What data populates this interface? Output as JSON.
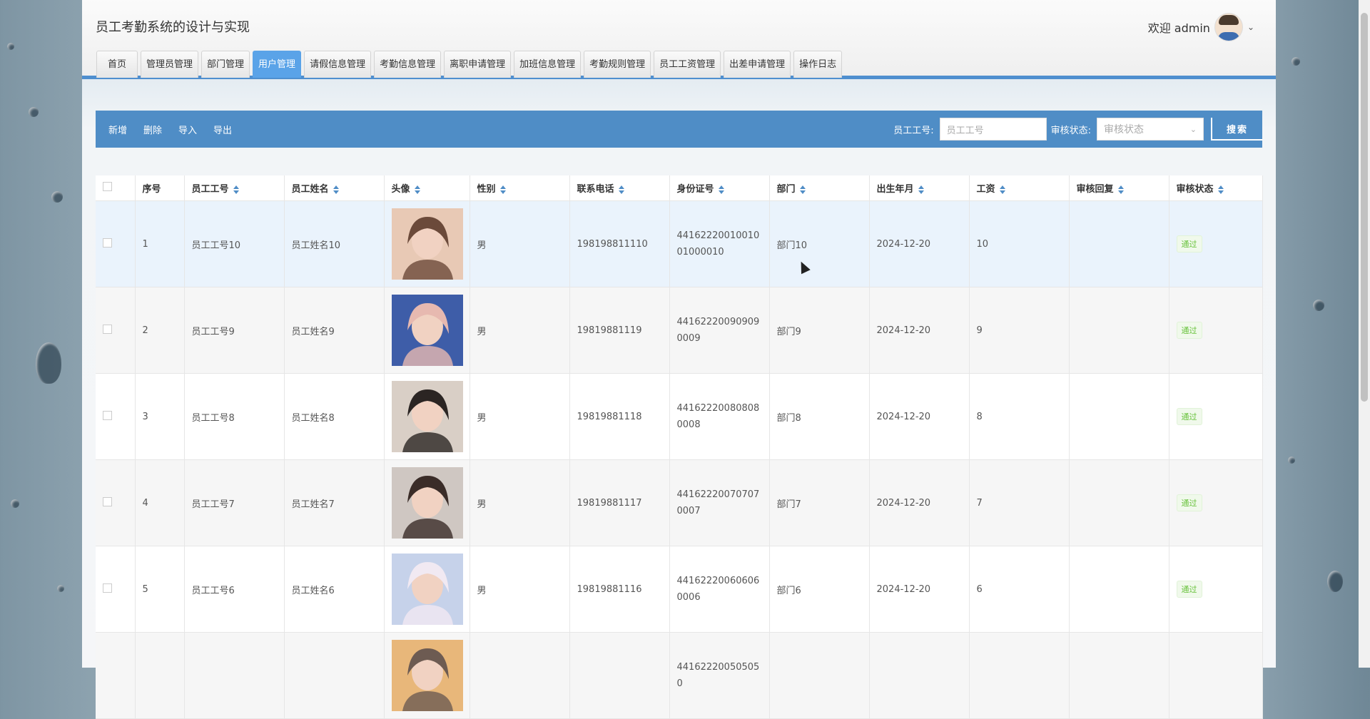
{
  "app": {
    "title": "员工考勤系统的设计与实现",
    "welcome": "欢迎 admin"
  },
  "nav": {
    "tabs": [
      {
        "label": "首页",
        "active": false
      },
      {
        "label": "管理员管理",
        "active": false
      },
      {
        "label": "部门管理",
        "active": false
      },
      {
        "label": "用户管理",
        "active": true
      },
      {
        "label": "请假信息管理",
        "active": false
      },
      {
        "label": "考勤信息管理",
        "active": false
      },
      {
        "label": "离职申请管理",
        "active": false
      },
      {
        "label": "加班信息管理",
        "active": false
      },
      {
        "label": "考勤规则管理",
        "active": false
      },
      {
        "label": "员工工资管理",
        "active": false
      },
      {
        "label": "出差申请管理",
        "active": false
      },
      {
        "label": "操作日志",
        "active": false
      }
    ]
  },
  "toolbar": {
    "add": "新增",
    "delete": "删除",
    "import": "导入",
    "export": "导出",
    "employee_no_label": "员工工号:",
    "employee_no_placeholder": "员工工号",
    "status_label": "审核状态:",
    "status_placeholder": "审核状态",
    "search": "搜索"
  },
  "table": {
    "headers": [
      "序号",
      "员工工号",
      "员工姓名",
      "头像",
      "性别",
      "联系电话",
      "身份证号",
      "部门",
      "出生年月",
      "工资",
      "审核回复",
      "审核状态"
    ],
    "rows": [
      {
        "idx": "1",
        "no": "员工工号10",
        "name": "员工姓名10",
        "gender": "男",
        "phone": "198198811110",
        "id": "4416222001001001000010",
        "dept": "部门10",
        "birth": "2024-12-20",
        "salary": "10",
        "reply": "",
        "status": "通过"
      },
      {
        "idx": "2",
        "no": "员工工号9",
        "name": "员工姓名9",
        "gender": "男",
        "phone": "19819881119",
        "id": "441622200909090009",
        "dept": "部门9",
        "birth": "2024-12-20",
        "salary": "9",
        "reply": "",
        "status": "通过"
      },
      {
        "idx": "3",
        "no": "员工工号8",
        "name": "员工姓名8",
        "gender": "男",
        "phone": "19819881118",
        "id": "441622200808080008",
        "dept": "部门8",
        "birth": "2024-12-20",
        "salary": "8",
        "reply": "",
        "status": "通过"
      },
      {
        "idx": "4",
        "no": "员工工号7",
        "name": "员工姓名7",
        "gender": "男",
        "phone": "19819881117",
        "id": "441622200707070007",
        "dept": "部门7",
        "birth": "2024-12-20",
        "salary": "7",
        "reply": "",
        "status": "通过"
      },
      {
        "idx": "5",
        "no": "员工工号6",
        "name": "员工姓名6",
        "gender": "男",
        "phone": "19819881116",
        "id": "441622200606060006",
        "dept": "部门6",
        "birth": "2024-12-20",
        "salary": "6",
        "reply": "",
        "status": "通过"
      },
      {
        "idx": "",
        "no": "",
        "name": "",
        "gender": "",
        "phone": "",
        "id": "441622200505050",
        "dept": "",
        "birth": "",
        "salary": "",
        "reply": "",
        "status": ""
      }
    ],
    "photo_colors": [
      [
        "#e8c9b5",
        "#6b4a3a"
      ],
      [
        "#3e5da8",
        "#e7b9b0"
      ],
      [
        "#d9cfc6",
        "#2b2523"
      ],
      [
        "#cfc7c2",
        "#3a2c28"
      ],
      [
        "#c6d2ea",
        "#f1e9f2"
      ],
      [
        "#e8b77a",
        "#6d5b52"
      ]
    ]
  }
}
